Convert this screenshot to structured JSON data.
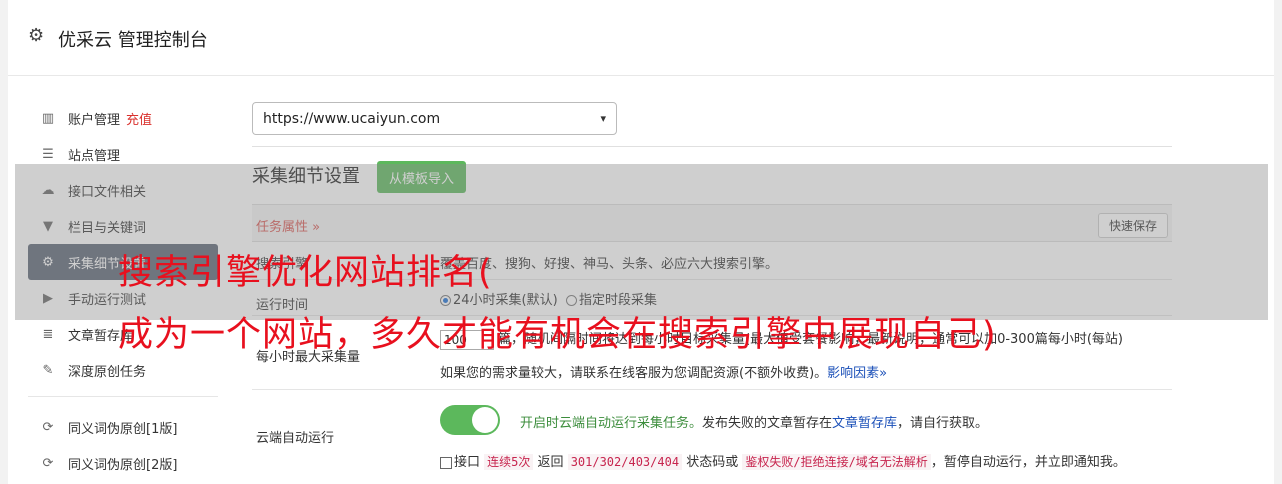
{
  "header": {
    "title": "优采云 管理控制台",
    "icon": "gear-icon"
  },
  "sidebar": {
    "items": [
      {
        "icon": "bar-chart-icon",
        "glyph": "▥",
        "label": "账户管理",
        "extra": "充值"
      },
      {
        "icon": "server-icon",
        "glyph": "☰",
        "label": "站点管理"
      },
      {
        "icon": "cloud-upload-icon",
        "glyph": "☁",
        "label": "接口文件相关"
      },
      {
        "icon": "filter-icon",
        "glyph": "▼",
        "label": "栏目与关键词"
      },
      {
        "icon": "cogs-icon",
        "glyph": "⚙",
        "label": "采集细节设置",
        "active": true
      },
      {
        "icon": "play-circle-icon",
        "glyph": "▶",
        "label": "手动运行测试"
      },
      {
        "icon": "database-icon",
        "glyph": "≣",
        "label": "文章暂存库"
      },
      {
        "icon": "edit-icon",
        "glyph": "✎",
        "label": "深度原创任务"
      }
    ],
    "items2": [
      {
        "icon": "refresh-icon",
        "glyph": "⟳",
        "label": "同义词伪原创[1版]"
      },
      {
        "icon": "refresh-icon",
        "glyph": "⟳",
        "label": "同义词伪原创[2版]"
      }
    ]
  },
  "main": {
    "site_select": "https://www.ucaiyun.com",
    "section_title": "采集细节设置",
    "import_button": "从模板导入",
    "task_props": "任务属性",
    "task_props_chevron": "»",
    "quick_save": "快速保存",
    "rows": {
      "engines": {
        "label": "搜索引擎",
        "value": "覆盖百度、搜狗、好搜、神马、头条、必应六大搜索引擎。"
      },
      "run_time": {
        "label": "运行时间",
        "opt1": "24小时采集(默认)",
        "opt2": "指定时段采集"
      },
      "max_per_hour": {
        "label": "每小时最大采集量",
        "input": "100",
        "text1": "篇，随机间隔时间将达到每小时目标采集量(最大值受套餐影响，最新说明，通常可以加0-300篇每小时(每站)",
        "text2": "如果您的需求量较大，请联系在线客服为您调配资源(不额外收费)。",
        "link": "影响因素",
        "link_chevron": "»"
      },
      "cloud_run": {
        "label": "云端自动运行",
        "toggle_on": true,
        "green": "开启时云端自动运行采集任务。",
        "text_a": "发布失败的文章暂存在",
        "link": "文章暂存库",
        "text_b": "，请自行获取。",
        "chk_label": "接口",
        "code1": "连续5次",
        "mid1": "返回",
        "code2": "301/302/403/404",
        "mid2": "状态码或",
        "code3": "鉴权失败/拒绝连接/域名无法解析",
        "tail": "，暂停自动运行，并立即通知我。"
      }
    }
  },
  "overlay": {
    "line1": "搜索引擎优化网站排名(",
    "line2": "成为一个网站，多久才能有机会在搜索引擎中展现自己)"
  }
}
